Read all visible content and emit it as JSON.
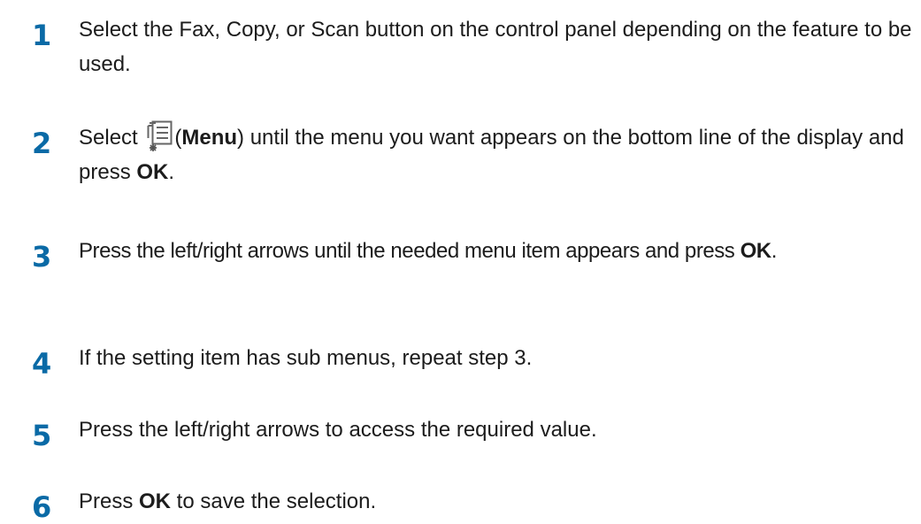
{
  "steps": [
    {
      "number": "1",
      "text": "Select the Fax, Copy, or Scan button on the control panel depending on the feature to be used."
    },
    {
      "number": "2",
      "text_before": "Select ",
      "icon": "menu-icon",
      "text_open_paren": "(",
      "bold": "Menu",
      "text_after": ") until the menu you want appears on the bottom line of the display and press ",
      "bold2": "OK",
      "text_end": "."
    },
    {
      "number": "3",
      "text_before": "Press the left/right arrows until the needed menu item appears and press ",
      "bold": "OK",
      "text_end": "."
    },
    {
      "number": "4",
      "text": "If the setting item has sub menus, repeat step 3."
    },
    {
      "number": "5",
      "text": "Press the left/right arrows to access the required value."
    },
    {
      "number": "6",
      "text_before": "Press ",
      "bold": "OK",
      "text_after": " to save the selection."
    }
  ],
  "colors": {
    "step_number": "#0a6aa6",
    "text": "#1c1c1c"
  }
}
